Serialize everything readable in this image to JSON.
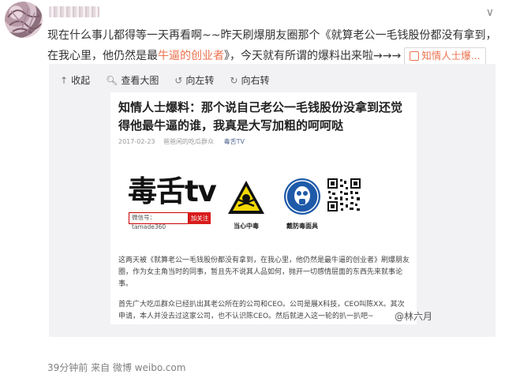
{
  "post": {
    "text_before": "现在什么事儿都得等一天再看啊~~昨天刷爆朋友圈那个《就算老公一毛钱股份都没有拿到，在我心里，他仍然是最",
    "link1": "牛逼的",
    "link2": "创业者",
    "text_after": "》，今天就有所谓的爆料出来啦→→→",
    "tag_label": "知情人士爆..."
  },
  "toolbar": {
    "collapse": "收起",
    "view_large": "查看大图",
    "rotate_left": "向左转",
    "rotate_right": "向右转"
  },
  "article": {
    "title": "知情人士爆料：那个说自己老公一毛钱股份没拿到还觉得他最牛逼的谁，我真是大写加粗的呵呵哒",
    "date": "2017-02-23",
    "author": "爸爸闲的吃瓜群众",
    "source": "毒舌TV",
    "logo": "毒舌tv",
    "wechat": "微信号：tamade360",
    "follow": "加关注",
    "warn_label": "当心中毒",
    "mask_label": "戴防毒面具",
    "para1": "这两天被《就算老公一毛钱股份都没有拿到，在我心里，他仍然是最牛逼的创业者》刷爆朋友圈，作为女主角当时的同事，暂且先不说其人品如何，抛开一切感情层面的东西先来就事论事。",
    "para2": "首先广大吃瓜群众已经扒出其老公所在的公司和CEO。公司是展X科技，CEO叫陈XX。其次申请，本人并没去过这家公司，也不认识陈CEO。然后就进入这一轮的扒一扒吧~"
  },
  "watermark": "@林六月",
  "footer": "39分钟前 来自 微博 weibo.com",
  "colors": {
    "link": "#eb7350",
    "source": "#576b95",
    "media_bg": "#f2f2f5"
  }
}
